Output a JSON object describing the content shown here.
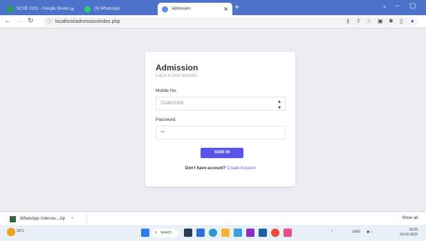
{
  "browser": {
    "tabs": [
      {
        "label": "SCHE 0101 - Google Sheets"
      },
      {
        "label": "(3) WhatsApp"
      },
      {
        "label": "Admission"
      }
    ],
    "url": "localhost/admission/index.php"
  },
  "card": {
    "title": "Admission",
    "subtitle": "Log in to your account.",
    "mobile_label": "Mobile No.",
    "mobile_value": "7218672323",
    "password_label": "Password",
    "password_value": "•••",
    "signin_label": "SIGN IN",
    "footer_prompt": "Don't have account?",
    "create_link": "Create Account"
  },
  "downloads": {
    "item": "WhatsApp Unknow....zip",
    "show_all": "Show all"
  },
  "taskbar": {
    "weather": "29°C",
    "search": "Search",
    "lang": "ENG",
    "time": "15:05",
    "date": "03-02-2023"
  },
  "colors": {
    "accent": "#5a54ea",
    "tabstrip": "#4d72c9",
    "page_bg": "#ececf3"
  }
}
